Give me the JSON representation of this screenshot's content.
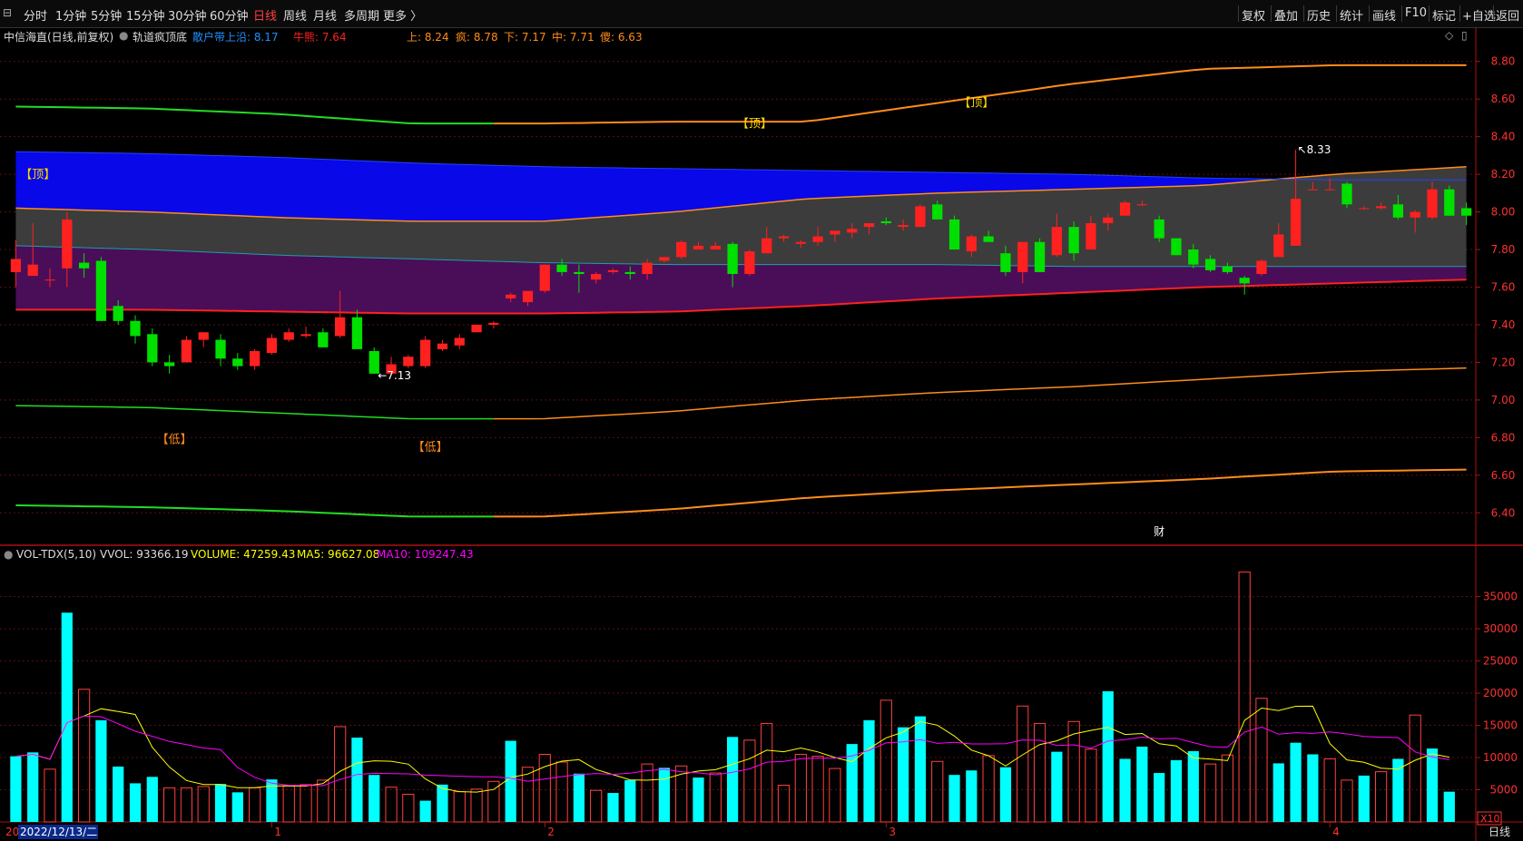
{
  "toolbar": {
    "periods": [
      "分时",
      "1分钟",
      "5分钟",
      "15分钟",
      "30分钟",
      "60分钟",
      "日线",
      "周线",
      "月线",
      "多周期",
      "更多 〉"
    ],
    "active_period": "日线",
    "actions": [
      "复权",
      "叠加",
      "历史",
      "统计",
      "画线",
      "F10",
      "标记",
      "+自选",
      "返回"
    ]
  },
  "info": {
    "stock": "中信海直(日线,前复权)",
    "indicator": "轨道疯顶底",
    "retail_label": "散户带上沿: 8.17",
    "bull_label": "牛熊: 7.64",
    "upper_label": "上: 8.24",
    "crazy_label": "疯: 8.78",
    "lower_label": "下: 7.17",
    "mid_label": "中: 7.71",
    "silly_label": "傻: 6.63"
  },
  "volume_info": {
    "name": "VOL-TDX(5,10)",
    "vvol": "VVOL: 93366.19",
    "volume": "VOLUME: 47259.43",
    "ma5": "MA5: 96627.08",
    "ma10": "MA10: 109247.43"
  },
  "annotations": {
    "tops": [
      "【顶】",
      "【顶】",
      "【顶】"
    ],
    "lows": [
      "【低】",
      "【低】"
    ],
    "min_label": "←7.13",
    "max_label": "↖8.33",
    "fin_label": "财"
  },
  "x_axis": {
    "date_label": "2022/12/13/二",
    "start_label": "20",
    "months": [
      "1",
      "2",
      "3",
      "4"
    ]
  },
  "volume_scale": "X10",
  "period_label": "日线",
  "colors": {
    "up": "#ff2020",
    "down": "#00e000",
    "vol_up": "#ff4040",
    "vol_down": "#00ffff",
    "band_blue": "#0808e8",
    "band_gray": "#3c3c3c",
    "band_purple": "#4a0e58",
    "orange": "#ff8c1a",
    "green_line": "#22dd22",
    "red_line": "#ff2020",
    "ma5": "#ffff00",
    "ma10": "#ff00ff",
    "axis": "#b01010"
  },
  "chart_data": [
    {
      "type": "candlestick",
      "title": "中信海直(日线,前复权)",
      "ylim": [
        6.3,
        8.9
      ],
      "yticks": [
        6.4,
        6.6,
        6.8,
        7.0,
        7.2,
        7.4,
        7.6,
        7.8,
        8.0,
        8.2,
        8.4,
        8.6,
        8.8
      ],
      "ohlc": [
        [
          7.68,
          7.85,
          7.6,
          7.75
        ],
        [
          7.66,
          7.94,
          7.66,
          7.72
        ],
        [
          7.64,
          7.7,
          7.6,
          7.64
        ],
        [
          7.7,
          8.0,
          7.6,
          7.96
        ],
        [
          7.73,
          7.78,
          7.65,
          7.7
        ],
        [
          7.74,
          7.76,
          7.42,
          7.42
        ],
        [
          7.5,
          7.53,
          7.4,
          7.42
        ],
        [
          7.42,
          7.45,
          7.3,
          7.34
        ],
        [
          7.35,
          7.38,
          7.18,
          7.2
        ],
        [
          7.2,
          7.24,
          7.14,
          7.18
        ],
        [
          7.2,
          7.34,
          7.2,
          7.32
        ],
        [
          7.32,
          7.36,
          7.28,
          7.36
        ],
        [
          7.32,
          7.35,
          7.18,
          7.22
        ],
        [
          7.22,
          7.25,
          7.16,
          7.18
        ],
        [
          7.18,
          7.27,
          7.16,
          7.26
        ],
        [
          7.25,
          7.35,
          7.24,
          7.33
        ],
        [
          7.32,
          7.38,
          7.31,
          7.36
        ],
        [
          7.34,
          7.39,
          7.33,
          7.35
        ],
        [
          7.36,
          7.38,
          7.28,
          7.28
        ],
        [
          7.34,
          7.58,
          7.33,
          7.44
        ],
        [
          7.44,
          7.48,
          7.28,
          7.27
        ],
        [
          7.26,
          7.28,
          7.14,
          7.14
        ],
        [
          7.14,
          7.23,
          7.13,
          7.19
        ],
        [
          7.18,
          7.24,
          7.17,
          7.23
        ],
        [
          7.18,
          7.34,
          7.17,
          7.32
        ],
        [
          7.27,
          7.32,
          7.26,
          7.3
        ],
        [
          7.29,
          7.35,
          7.27,
          7.33
        ],
        [
          7.36,
          7.4,
          7.36,
          7.4
        ],
        [
          7.4,
          7.42,
          7.38,
          7.41
        ],
        [
          7.54,
          7.57,
          7.52,
          7.56
        ],
        [
          7.52,
          7.58,
          7.5,
          7.58
        ],
        [
          7.58,
          7.72,
          7.57,
          7.72
        ],
        [
          7.72,
          7.75,
          7.66,
          7.68
        ],
        [
          7.68,
          7.72,
          7.57,
          7.67
        ],
        [
          7.64,
          7.68,
          7.62,
          7.67
        ],
        [
          7.68,
          7.7,
          7.67,
          7.69
        ],
        [
          7.68,
          7.71,
          7.64,
          7.67
        ],
        [
          7.67,
          7.75,
          7.64,
          7.73
        ],
        [
          7.74,
          7.76,
          7.73,
          7.76
        ],
        [
          7.76,
          7.85,
          7.75,
          7.84
        ],
        [
          7.8,
          7.84,
          7.8,
          7.82
        ],
        [
          7.8,
          7.84,
          7.8,
          7.82
        ],
        [
          7.83,
          7.84,
          7.6,
          7.67
        ],
        [
          7.67,
          7.8,
          7.66,
          7.79
        ],
        [
          7.78,
          7.92,
          7.78,
          7.86
        ],
        [
          7.86,
          7.88,
          7.84,
          7.87
        ],
        [
          7.83,
          7.85,
          7.81,
          7.84
        ],
        [
          7.84,
          7.92,
          7.82,
          7.87
        ],
        [
          7.88,
          7.9,
          7.84,
          7.9
        ],
        [
          7.89,
          7.94,
          7.86,
          7.91
        ],
        [
          7.92,
          7.94,
          7.88,
          7.94
        ],
        [
          7.95,
          7.97,
          7.93,
          7.94
        ],
        [
          7.92,
          7.96,
          7.9,
          7.93
        ],
        [
          7.92,
          8.04,
          7.92,
          8.03
        ],
        [
          8.04,
          8.06,
          7.96,
          7.96
        ],
        [
          7.96,
          7.98,
          7.8,
          7.8
        ],
        [
          7.79,
          7.88,
          7.76,
          7.87
        ],
        [
          7.87,
          7.9,
          7.84,
          7.84
        ],
        [
          7.78,
          7.82,
          7.66,
          7.68
        ],
        [
          7.68,
          7.84,
          7.62,
          7.84
        ],
        [
          7.84,
          7.86,
          7.68,
          7.68
        ],
        [
          7.77,
          7.99,
          7.76,
          7.92
        ],
        [
          7.92,
          7.95,
          7.74,
          7.78
        ],
        [
          7.8,
          7.98,
          7.8,
          7.94
        ],
        [
          7.94,
          7.99,
          7.9,
          7.97
        ],
        [
          7.98,
          8.06,
          7.98,
          8.05
        ],
        [
          8.04,
          8.06,
          8.03,
          8.04
        ],
        [
          7.96,
          7.98,
          7.84,
          7.86
        ],
        [
          7.86,
          7.86,
          7.77,
          7.77
        ],
        [
          7.8,
          7.83,
          7.7,
          7.72
        ],
        [
          7.75,
          7.77,
          7.68,
          7.69
        ],
        [
          7.71,
          7.73,
          7.67,
          7.68
        ],
        [
          7.65,
          7.66,
          7.56,
          7.62
        ],
        [
          7.67,
          7.75,
          7.66,
          7.74
        ],
        [
          7.76,
          7.94,
          7.76,
          7.88
        ],
        [
          7.82,
          8.33,
          7.82,
          8.07
        ],
        [
          8.12,
          8.16,
          8.12,
          8.12
        ],
        [
          8.12,
          8.18,
          8.12,
          8.12
        ],
        [
          8.15,
          8.16,
          8.02,
          8.04
        ],
        [
          8.02,
          8.03,
          8.01,
          8.02
        ],
        [
          8.02,
          8.05,
          8.01,
          8.03
        ],
        [
          8.04,
          8.09,
          7.96,
          7.97
        ],
        [
          7.97,
          8.01,
          7.89,
          8.0
        ],
        [
          7.97,
          8.16,
          7.96,
          8.12
        ],
        [
          8.12,
          8.14,
          7.98,
          7.98
        ],
        [
          8.02,
          8.05,
          7.93,
          7.98
        ]
      ],
      "bands": {
        "crazy": [
          8.56,
          8.55,
          8.52,
          8.47,
          8.47,
          8.48,
          8.48,
          8.58,
          8.68,
          8.76,
          8.78,
          8.78
        ],
        "upper": [
          8.02,
          8.0,
          7.97,
          7.95,
          7.95,
          8.0,
          8.07,
          8.1,
          8.12,
          8.14,
          8.2,
          8.24
        ],
        "retail": [
          8.32,
          8.31,
          8.29,
          8.26,
          8.24,
          8.23,
          8.22,
          8.21,
          8.2,
          8.18,
          8.17,
          8.17
        ],
        "mid": [
          7.82,
          7.8,
          7.77,
          7.75,
          7.73,
          7.72,
          7.72,
          7.72,
          7.71,
          7.71,
          7.71,
          7.71
        ],
        "bull": [
          7.48,
          7.48,
          7.47,
          7.46,
          7.46,
          7.47,
          7.5,
          7.54,
          7.57,
          7.6,
          7.62,
          7.64
        ],
        "lower": [
          6.97,
          6.96,
          6.93,
          6.9,
          6.9,
          6.94,
          7.0,
          7.04,
          7.07,
          7.11,
          7.15,
          7.17
        ],
        "silly": [
          6.44,
          6.43,
          6.41,
          6.38,
          6.38,
          6.42,
          6.48,
          6.52,
          6.55,
          6.58,
          6.62,
          6.63
        ]
      }
    },
    {
      "type": "bar",
      "title": "VOL-TDX(5,10)",
      "ylabel": "X10",
      "ylim": [
        0,
        41000
      ],
      "yticks": [
        5000,
        10000,
        15000,
        20000,
        25000,
        30000,
        35000
      ],
      "values": [
        10200,
        10800,
        8200,
        32500,
        20600,
        15800,
        8600,
        6000,
        7000,
        5300,
        5300,
        5500,
        5900,
        4600,
        5300,
        6600,
        5600,
        5800,
        6500,
        14800,
        13100,
        7300,
        5400,
        4300,
        3300,
        5800,
        4700,
        5100,
        6300,
        12600,
        8500,
        10500,
        9300,
        7500,
        4900,
        4500,
        6500,
        9000,
        8400,
        8700,
        6900,
        7600,
        13200,
        12700,
        15300,
        5700,
        10500,
        10200,
        8300,
        12100,
        15800,
        18900,
        14700,
        16400,
        9400,
        7300,
        8000,
        10300,
        8500,
        18000,
        15300,
        10900,
        15600,
        11300,
        20300,
        9800,
        11700,
        7600,
        9600,
        11000,
        9000,
        10400,
        38800,
        19200,
        9100,
        12300,
        10500,
        9800,
        6500,
        7200,
        7800,
        9800,
        16600,
        11400,
        4700
      ],
      "up": [
        0,
        0,
        1,
        0,
        1,
        0,
        0,
        0,
        0,
        1,
        1,
        1,
        0,
        0,
        1,
        0,
        1,
        1,
        1,
        1,
        0,
        0,
        1,
        1,
        0,
        0,
        1,
        1,
        1,
        0,
        1,
        1,
        1,
        0,
        1,
        0,
        0,
        1,
        0,
        1,
        0,
        1,
        0,
        1,
        1,
        1,
        1,
        1,
        1,
        0,
        0,
        1,
        0,
        0,
        1,
        0,
        0,
        1,
        0,
        1,
        1,
        0,
        1,
        1,
        0,
        0,
        0,
        0,
        0,
        0,
        1,
        1,
        1,
        1,
        0,
        0,
        0,
        1,
        1,
        0,
        1,
        0,
        1,
        0,
        0
      ],
      "vvol_last": 93366.19,
      "volume_last": 47259.43,
      "ma5_last": 96627.08,
      "ma10_last": 109247.43
    }
  ]
}
